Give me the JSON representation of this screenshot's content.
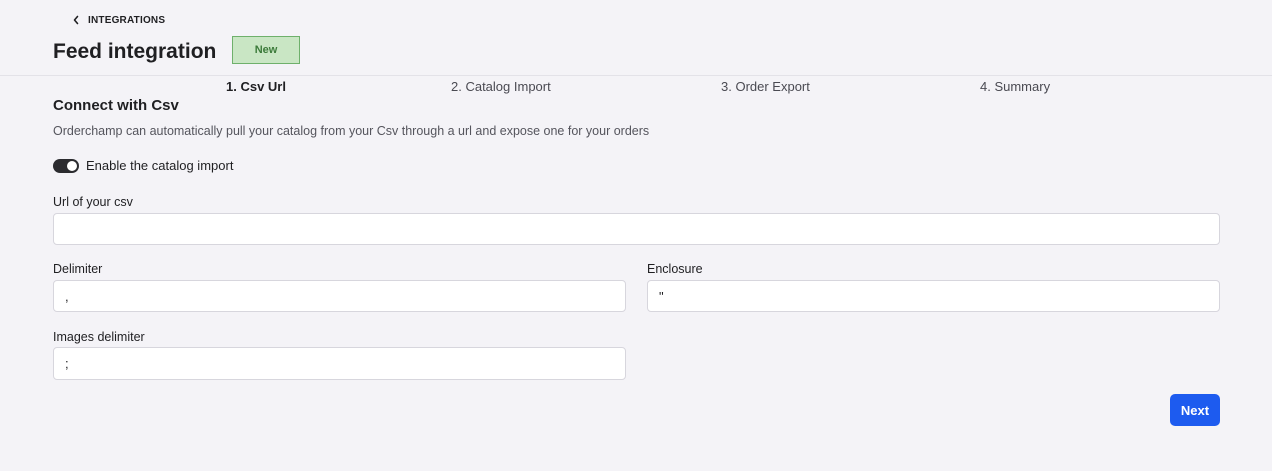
{
  "header": {
    "back_label": "INTEGRATIONS",
    "title": "Feed integration",
    "status_badge": "New"
  },
  "steps": [
    {
      "label": "1. Csv Url",
      "active": true
    },
    {
      "label": "2. Catalog Import",
      "active": false
    },
    {
      "label": "3. Order Export",
      "active": false
    },
    {
      "label": "4. Summary",
      "active": false
    }
  ],
  "section": {
    "title": "Connect with Csv",
    "description": "Orderchamp can automatically pull your catalog from your Csv through a url and expose one for your orders"
  },
  "toggle": {
    "label": "Enable the catalog import",
    "enabled": true
  },
  "form": {
    "url": {
      "label": "Url of your csv",
      "value": ""
    },
    "delimiter": {
      "label": "Delimiter",
      "value": ","
    },
    "enclosure": {
      "label": "Enclosure",
      "value": "\""
    },
    "images_delimiter": {
      "label": "Images delimiter",
      "value": ";"
    }
  },
  "actions": {
    "next_label": "Next"
  },
  "colors": {
    "background": "#f4f3f7",
    "badge_bg": "#c9e6c4",
    "badge_border": "#6eb06b",
    "primary": "#1d5bef"
  },
  "icons": {
    "back": "chevron-left-icon"
  }
}
